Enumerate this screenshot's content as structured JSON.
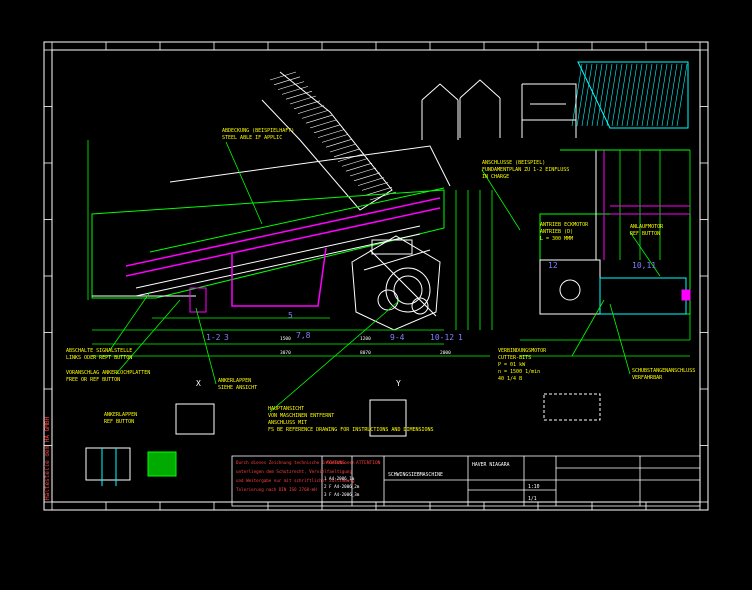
{
  "colors": {
    "background": "#000000",
    "frame": "#ffffff",
    "primary_lines": "#ffffff",
    "construction": "#00ff00",
    "highlight": "#ff00ff",
    "machine": "#00ffff",
    "labels": "#ffff00",
    "title_block_text": "#ff4040",
    "hatch": "#ff8080",
    "grid_refs": "#ffff00"
  },
  "callouts": [
    {
      "id": "c-top",
      "lines": [
        "ABDECKUNG (BEISPIELHAFT)",
        "STEEL ABLE IF APPLIC"
      ]
    },
    {
      "id": "c-mid",
      "lines": [
        "ANSCHLUSSE (BEISPIEL)",
        "FUNDAMENTPLAN ZU 1-2 EINFLUSS",
        "IN CHARGE"
      ]
    },
    {
      "id": "c-left1",
      "lines": [
        "ABSCHALTE SIGNALSTELLE",
        "LINKS ODER REPT BUTTON"
      ]
    },
    {
      "id": "c-left2",
      "lines": [
        "VORANSCHLAG ANKERLOCHPLATTEN",
        "FREE OR REF BUTTON"
      ]
    },
    {
      "id": "c-center",
      "lines": [
        "HAUPTANSICHT",
        "VON MASCHINEN ENTFERNT",
        "ANSCHLUSS MIT",
        "FS BE REFERENCE DRAWING FOR INSTRUCTIONS AND DIMENSIONS"
      ]
    },
    {
      "id": "c-pin",
      "lines": [
        "ANKERLAPPEN",
        "SIEHE ANSICHT"
      ]
    },
    {
      "id": "c-right1",
      "lines": [
        "ANTRIEB ECKMOTOR",
        "ANTRIEB (D)",
        "L = 300 MMM"
      ]
    },
    {
      "id": "c-right2",
      "lines": [
        "ANLAUFMOTOR",
        "REF BUTTON"
      ]
    },
    {
      "id": "c-right3",
      "lines": [
        "VERBINDUNGSMOTOR",
        "CUTTER-BITS",
        "P = 01 kW",
        "n = 1500 1/min",
        "40 1/4 B"
      ]
    },
    {
      "id": "c-right4",
      "lines": [
        "SCHUBSTANGENANSCHLUSS",
        "VERFAHRBAR"
      ]
    },
    {
      "id": "c-anchor",
      "lines": [
        "ANKERLAPPEN",
        "REF BUTTON"
      ]
    }
  ],
  "section_labels": [
    "1-2",
    "3",
    "7,8",
    "5",
    "9-4",
    "10-12",
    "1",
    "12",
    "10,11"
  ],
  "view_marks": [
    "X",
    "Y"
  ],
  "dims": [
    "3070",
    "8070",
    "2000",
    "1500",
    "1200"
  ],
  "title_block": {
    "side_title": "Haltestelle dem HA GMBH",
    "notes": [
      "Durch dieses Zeichnung technische Informationen",
      "unterliegen dem Schutzrecht. Vervielfaeltigung",
      "und Weitergabe nur mit schriftlicher Zustimmung",
      "Tolerierung nach DIN ISO 2768-mH"
    ],
    "warning_head": "ACHTUNG",
    "warning_head2": "ATTENTION",
    "revisions": [
      "1  A4-2006_1m",
      "2  F A4-2006_2m",
      "3  F A4-2006_3m"
    ],
    "company": "HAVER NIAGARA",
    "drawing_title": "SCHWINGSIEBMASCHINE",
    "scale": "1:10",
    "sheet": "1/1"
  }
}
